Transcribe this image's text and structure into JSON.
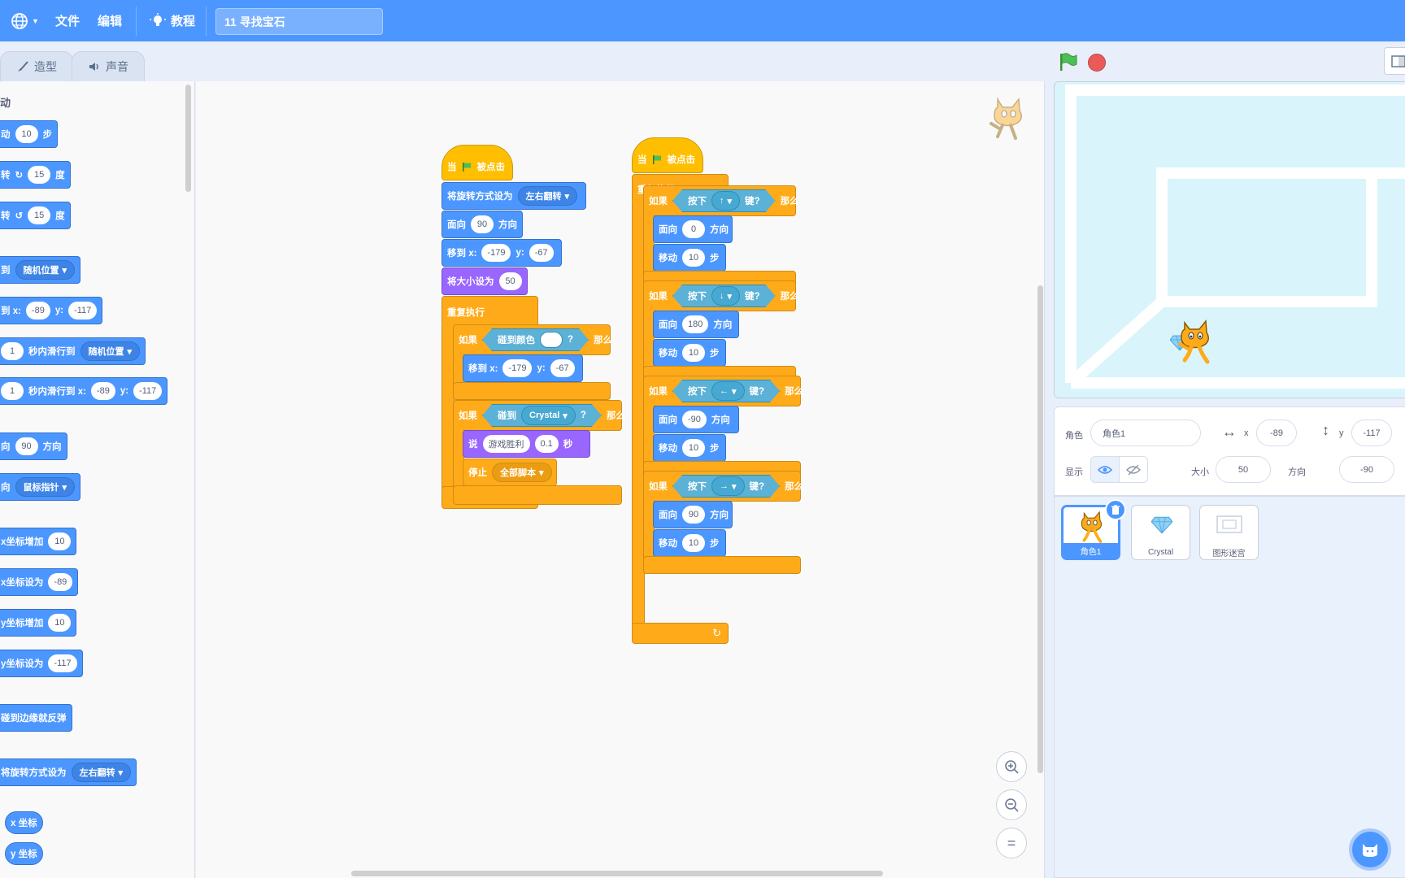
{
  "menu": {
    "file": "文件",
    "edit": "编辑",
    "tutorials": "教程",
    "project_title": "11 寻找宝石"
  },
  "tabs": {
    "costumes": "造型",
    "sounds": "声音"
  },
  "palette": {
    "category_fragment": "动",
    "blocks": [
      {
        "prefix": "动",
        "value": "10",
        "suffix": "步"
      },
      {
        "prefix": "转",
        "value": "15",
        "suffix": "度"
      },
      {
        "prefix": "转",
        "value": "15",
        "suffix": "度"
      },
      {
        "prefix": "到",
        "dropdown": "随机位置"
      },
      {
        "prefix": "到 x:",
        "x": "-89",
        "ylabel": "y:",
        "y": "-117"
      },
      {
        "value": "1",
        "label": "秒内滑行到",
        "dropdown": "随机位置"
      },
      {
        "value": "1",
        "label": "秒内滑行到 x:",
        "x": "-89",
        "ylabel": "y:",
        "y": "-117"
      },
      {
        "prefix": "向",
        "value": "90",
        "suffix": "方向"
      },
      {
        "prefix": "向",
        "dropdown": "鼠标指针"
      },
      {
        "label": "x坐标增加",
        "value": "10"
      },
      {
        "label": "x坐标设为",
        "value": "-89"
      },
      {
        "label": "y坐标增加",
        "value": "10"
      },
      {
        "label": "y坐标设为",
        "value": "-117"
      },
      {
        "label": "碰到边缘就反弹"
      },
      {
        "label": "将旋转方式设为",
        "dropdown": "左右翻转"
      },
      {
        "label": "x 坐标"
      },
      {
        "label": "y 坐标"
      }
    ]
  },
  "script1": {
    "hat": {
      "when": "当",
      "clicked": "被点击"
    },
    "rotation": {
      "label": "将旋转方式设为",
      "value": "左右翻转"
    },
    "point": {
      "label": "面向",
      "value": "90",
      "suffix": "方向"
    },
    "goto": {
      "label": "移到 x:",
      "x": "-179",
      "ylabel": "y:",
      "y": "-67"
    },
    "size": {
      "label": "将大小设为",
      "value": "50"
    },
    "forever": "重复执行",
    "if1": {
      "if": "如果",
      "cond": "碰到颜色",
      "q": "?",
      "then": "那么"
    },
    "goto2": {
      "label": "移到 x:",
      "x": "-179",
      "ylabel": "y:",
      "y": "-67"
    },
    "if2": {
      "if": "如果",
      "cond": "碰到",
      "target": "Crystal",
      "q": "?",
      "then": "那么"
    },
    "say": {
      "label": "说",
      "text": "游戏胜利",
      "secs": "0.1",
      "unit": "秒"
    },
    "stop": {
      "label": "停止",
      "value": "全部脚本"
    }
  },
  "script2": {
    "hat": {
      "when": "当",
      "clicked": "被点击"
    },
    "forever": "重复执行",
    "ifs": [
      {
        "if": "如果",
        "press": "按下",
        "key": "↑",
        "keysuffix": "键?",
        "then": "那么",
        "point_label": "面向",
        "dir": "0",
        "dir_suffix": "方向",
        "move_label": "移动",
        "steps": "10",
        "steps_suffix": "步"
      },
      {
        "if": "如果",
        "press": "按下",
        "key": "↓",
        "keysuffix": "键?",
        "then": "那么",
        "point_label": "面向",
        "dir": "180",
        "dir_suffix": "方向",
        "move_label": "移动",
        "steps": "10",
        "steps_suffix": "步"
      },
      {
        "if": "如果",
        "press": "按下",
        "key": "←",
        "keysuffix": "键?",
        "then": "那么",
        "point_label": "面向",
        "dir": "-90",
        "dir_suffix": "方向",
        "move_label": "移动",
        "steps": "10",
        "steps_suffix": "步"
      },
      {
        "if": "如果",
        "press": "按下",
        "key": "→",
        "keysuffix": "键?",
        "then": "那么",
        "point_label": "面向",
        "dir": "90",
        "dir_suffix": "方向",
        "move_label": "移动",
        "steps": "10",
        "steps_suffix": "步"
      }
    ]
  },
  "sprite_info": {
    "sprite_label": "角色",
    "sprite_name": "角色1",
    "x_label": "x",
    "x": "-89",
    "y_label": "y",
    "y": "-117",
    "show_label": "显示",
    "size_label": "大小",
    "size": "50",
    "direction_label": "方向",
    "direction": "-90"
  },
  "sprites": [
    {
      "name": "角色1",
      "selected": true
    },
    {
      "name": "Crystal",
      "selected": false
    },
    {
      "name": "图形迷宫",
      "selected": false
    }
  ],
  "colors": {
    "menu_bar": "#4c97ff",
    "motion": "#4c97ff",
    "control": "#ffab19",
    "events": "#ffbf00",
    "sensing": "#5cb1d6",
    "looks": "#9966ff"
  }
}
